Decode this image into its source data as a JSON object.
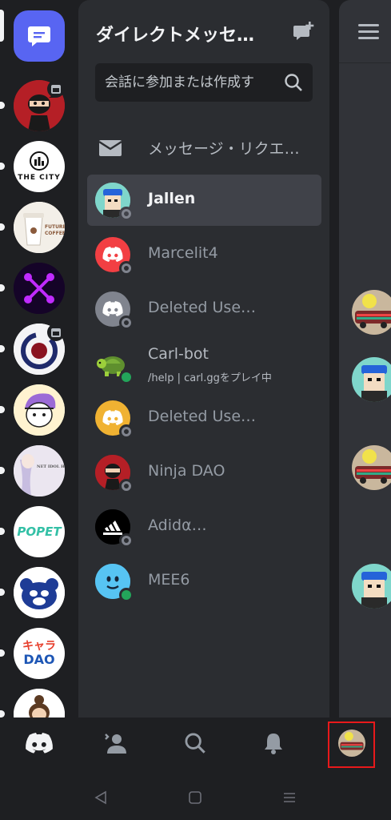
{
  "dm_panel": {
    "title": "ダイレクトメッセ…",
    "search": {
      "placeholder": "会話に参加または作成す"
    },
    "message_requests_label": "メッセージ・リクエ…",
    "conversations": [
      {
        "name": "Jallen",
        "status": "offline",
        "active": true,
        "avatar": "pixel-boy-blue-cap"
      },
      {
        "name": "Marcelit4",
        "status": "offline",
        "avatar": "discord-default-red"
      },
      {
        "name": "Deleted Use…",
        "status": "offline",
        "avatar": "discord-default-gray"
      },
      {
        "name": "Carl-bot",
        "status": "online",
        "activity": "/help | carl.ggをプレイ中",
        "avatar": "turtle"
      },
      {
        "name": "Deleted Use…",
        "status": "offline",
        "avatar": "discord-default-orange"
      },
      {
        "name": "Ninja DAO",
        "status": "offline",
        "avatar": "ninja"
      },
      {
        "name": "Adidα…",
        "status": "offline",
        "avatar": "adidas-logo"
      },
      {
        "name": "MEE6",
        "status": "online",
        "avatar": "mee6-blue-face"
      }
    ]
  },
  "servers": [
    {
      "name": "direct-messages-home",
      "icon": "chat-bubble-icon"
    },
    {
      "name": "ninja-server",
      "has_event": true
    },
    {
      "name": "the-city",
      "label": "THE CITY"
    },
    {
      "name": "future-coffee",
      "label": "FUTURE COFFEE"
    },
    {
      "name": "purple-x-server"
    },
    {
      "name": "red-circle-server",
      "has_event": true
    },
    {
      "name": "anime-girl-server"
    },
    {
      "name": "net-idol-house",
      "label": "NET IDOL HOUSE"
    },
    {
      "name": "popet",
      "label": "POPET"
    },
    {
      "name": "bear-server"
    },
    {
      "name": "chara-dao",
      "label_top": "キャラ",
      "label_bottom": "DAO"
    },
    {
      "name": "doll-server"
    }
  ],
  "bottom_nav": [
    "home-tab",
    "friends-tab",
    "search-tab",
    "notifications-tab",
    "profile-tab"
  ],
  "colors": {
    "blurple": "#5865f2",
    "background": "#1e1f22",
    "panel": "#2b2d31",
    "online": "#23a55a",
    "highlight": "#e8191b"
  }
}
